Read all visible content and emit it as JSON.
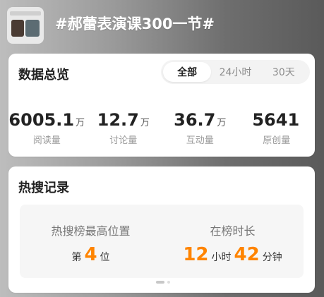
{
  "topic": {
    "title": "#郝蕾表演课300一节#"
  },
  "overview": {
    "title": "数据总览",
    "tabs": [
      "全部",
      "24小时",
      "30天"
    ],
    "active_tab": "全部",
    "stats": [
      {
        "value": "6005.1",
        "unit": "万",
        "label": "阅读量"
      },
      {
        "value": "12.7",
        "unit": "万",
        "label": "讨论量"
      },
      {
        "value": "36.7",
        "unit": "万",
        "label": "互动量"
      },
      {
        "value": "5641",
        "unit": "",
        "label": "原创量"
      }
    ]
  },
  "hot_search": {
    "title": "热搜记录",
    "highest_position": {
      "label": "热搜榜最高位置",
      "prefix": "第",
      "value": "4",
      "suffix": "位"
    },
    "duration": {
      "label": "在榜时长",
      "hours": "12",
      "hours_unit": "小时",
      "minutes": "42",
      "minutes_unit": "分钟"
    }
  },
  "colors": {
    "accent": "#ff8400"
  }
}
